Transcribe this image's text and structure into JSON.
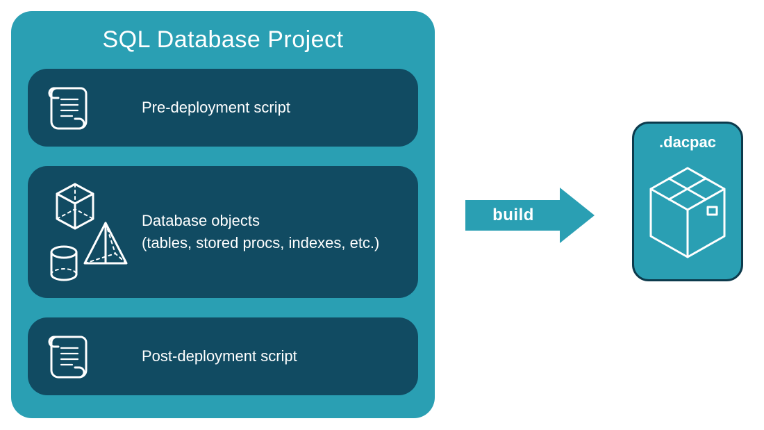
{
  "diagram": {
    "title": "SQL Database Project",
    "sections": {
      "pre": {
        "label": "Pre-deployment script"
      },
      "objects": {
        "line1": "Database objects",
        "line2": "(tables, stored procs, indexes, etc.)"
      },
      "post": {
        "label": "Post-deployment script"
      }
    },
    "arrow_label": "build",
    "output": {
      "label": ".dacpac"
    }
  },
  "colors": {
    "teal": "#2a9fb3",
    "dark": "#114b62",
    "line": "#ffffff"
  }
}
